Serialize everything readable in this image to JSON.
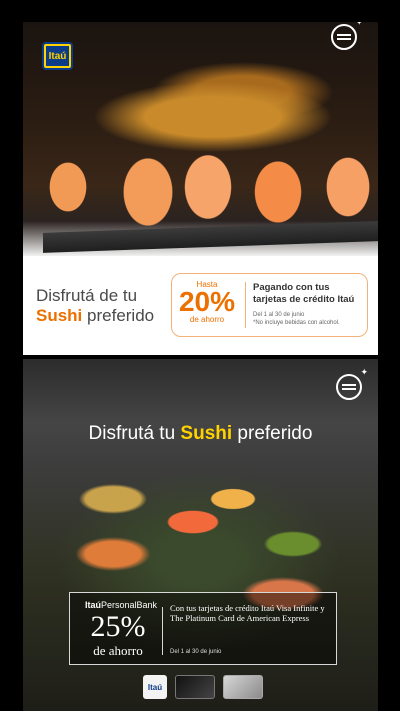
{
  "ad1": {
    "logo": "Itaú",
    "headline_line1": "Disfrutá de tu",
    "headline_accent": "Sushi",
    "headline_rest": " preferido",
    "offer": {
      "up_to": "Hasta",
      "percent": "20%",
      "save": "de ahorro",
      "pay_text": "Pagando con tus tarjetas de crédito Itaú",
      "dates": "Del 1 al 30 de junio",
      "note": "*No incluye bebidas con alcohol."
    }
  },
  "ad2": {
    "title_prefix": "Disfrutá tu ",
    "title_accent": "Sushi",
    "title_suffix": " preferido",
    "brand_bold": "Itaú",
    "brand_rest": "PersonalBank",
    "percent": "25%",
    "save": "de ahorro",
    "cards_text": "Con tus tarjetas de crédito Itaú Visa Infinite y The Platinum Card de American Express",
    "dates": "Del 1 al 30 de junio",
    "footer_logo": "Itaú"
  },
  "colors": {
    "brand_orange": "#ec7000",
    "brand_yellow": "#ffd200",
    "brand_blue": "#0b3c8a"
  }
}
